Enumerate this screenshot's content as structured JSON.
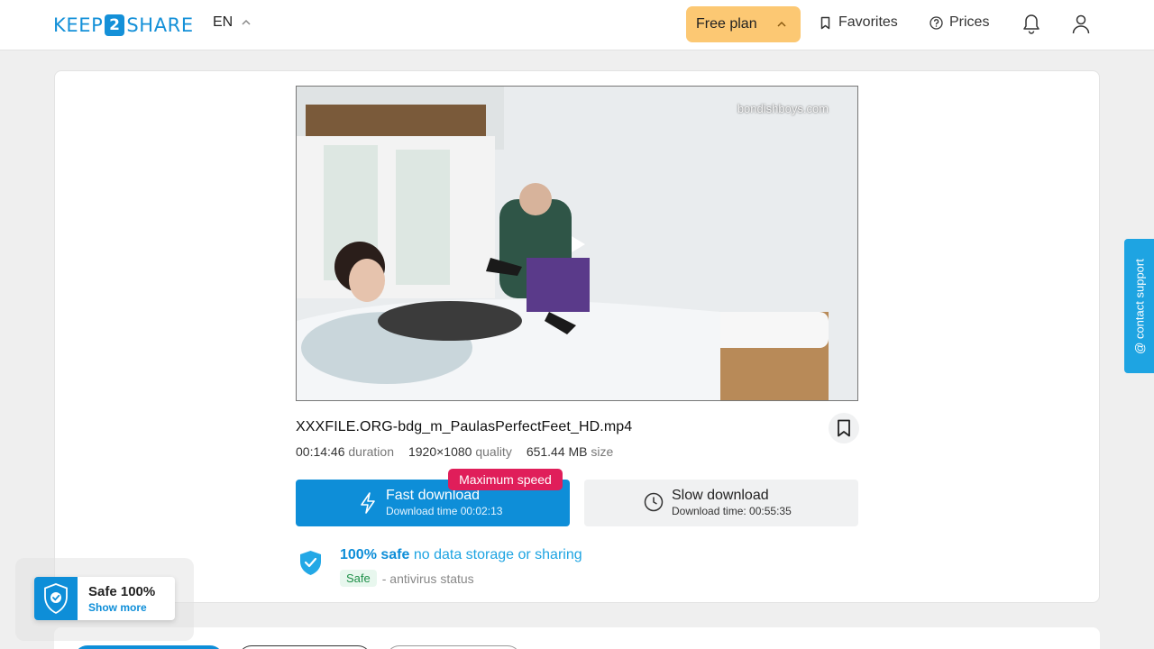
{
  "header": {
    "logo_left": "KEEP",
    "logo_mid": "2",
    "logo_right": "SHARE",
    "lang": "EN",
    "plan": "Free plan",
    "favorites": "Favorites",
    "prices": "Prices"
  },
  "video": {
    "watermark": "bondishboys.com"
  },
  "file": {
    "name": "XXXFILE.ORG-bdg_m_PaulasPerfectFeet_HD.mp4",
    "duration": "00:14:46",
    "duration_label": "duration",
    "quality": "1920×1080",
    "quality_label": "quality",
    "size": "651.44 MB",
    "size_label": "size"
  },
  "downloads": {
    "badge": "Maximum speed",
    "fast_title": "Fast download",
    "fast_sub": "Download time 00:02:13",
    "slow_title": "Slow download",
    "slow_sub": "Download time: 00:55:35"
  },
  "safety": {
    "strong": "100% safe",
    "rest": "no data storage or sharing",
    "tag": "Safe",
    "status": "- antivirus status"
  },
  "support": {
    "label": "@ contact support"
  },
  "widget": {
    "title": "Safe 100%",
    "link": "Show more"
  },
  "colors": {
    "accent": "#0e8ed8",
    "plan": "#fcc873",
    "badge": "#e01e5a"
  }
}
